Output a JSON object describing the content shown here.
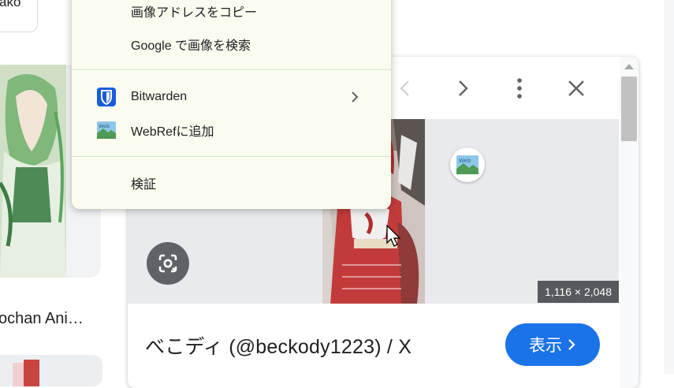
{
  "background": {
    "chip_text": "ako",
    "result_title": "ochan Ani…"
  },
  "context_menu": {
    "items": [
      {
        "label": "画像アドレスをコピー"
      },
      {
        "label": "Google で画像を検索"
      },
      {
        "label": "Bitwarden",
        "icon": "bitwarden-shield-icon",
        "has_submenu": true
      },
      {
        "label": "WebRefに追加",
        "icon": "webref-icon"
      },
      {
        "label": "検証"
      }
    ]
  },
  "preview": {
    "image_dimensions": "1,116 × 2,048",
    "page_title": "べこディ (@beckody1223) / X",
    "visit_label": "表示",
    "colors": {
      "visit_button": "#1a73e8",
      "menu_background": "#f9fcef"
    }
  }
}
